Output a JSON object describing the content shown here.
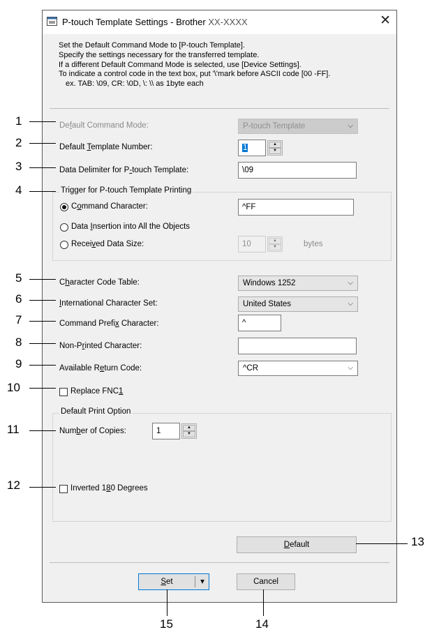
{
  "window": {
    "title": "P-touch Template Settings - Brother",
    "model": "XX-XXXX",
    "close_glyph": "✕"
  },
  "description": {
    "line1": "Set the Default Command Mode to [P-touch Template].",
    "line2": "Specify the settings necessary for the transferred template.",
    "line3": "If a different Default Command Mode is selected, use [Device Settings].",
    "line4": "To indicate a control code in the text box, put '\\'mark before ASCII code [00 -FF].",
    "line5": "ex. TAB: \\09,  CR: \\0D,  \\: \\\\  as 1byte each"
  },
  "fields": {
    "default_command_mode": {
      "label_pre": "De",
      "label_u": "f",
      "label_post": "ault Command Mode:",
      "value": "P-touch Template",
      "enabled": false
    },
    "default_template_number": {
      "label_pre": "Default ",
      "label_u": "T",
      "label_post": "emplate Number:",
      "value": "1"
    },
    "data_delimiter": {
      "label_pre": "Data Delimiter for P",
      "label_u": "-",
      "label_post": "touch Template:",
      "value": "\\09"
    },
    "trigger_group": {
      "label": "Trigger for P-touch Template Printing"
    },
    "command_character": {
      "label_pre": "C",
      "label_u": "o",
      "label_post": "mmand Character:",
      "value": "^FF",
      "selected": true
    },
    "data_insertion": {
      "label_pre": "Data ",
      "label_u": "I",
      "label_post": "nsertion into All the Objects",
      "selected": false
    },
    "received_data_size": {
      "label_pre": "Recei",
      "label_u": "v",
      "label_post": "ed Data Size:",
      "value": "10",
      "unit": "bytes",
      "selected": false
    },
    "character_code_table": {
      "label_pre": "C",
      "label_u": "h",
      "label_post": "aracter Code Table:",
      "value": "Windows 1252"
    },
    "international_character_set": {
      "label_pre": "",
      "label_u": "I",
      "label_post": "nternational Character Set:",
      "value": "United States"
    },
    "command_prefix_character": {
      "label_pre": "Command Prefi",
      "label_u": "x",
      "label_post": " Character:",
      "value": "^"
    },
    "non_printed_character": {
      "label_pre": "Non-P",
      "label_u": "r",
      "label_post": "inted Character:",
      "value": ""
    },
    "available_return_code": {
      "label_pre": "Available R",
      "label_u": "e",
      "label_post": "turn Code:",
      "value": "^CR"
    },
    "replace_fnc1": {
      "label_pre": "Replace FNC",
      "label_u": "1",
      "label_post": "",
      "checked": false
    },
    "default_print_option": {
      "label": "Default Print Option"
    },
    "number_of_copies": {
      "label_pre": "Num",
      "label_u": "b",
      "label_post": "er of Copies:",
      "value": "1"
    },
    "inverted_180": {
      "label_pre": "Inverted 1",
      "label_u": "8",
      "label_post": "0 Degrees",
      "checked": false
    }
  },
  "buttons": {
    "default": {
      "label_pre": "",
      "label_u": "D",
      "label_post": "efault"
    },
    "set": {
      "label_pre": "",
      "label_u": "S",
      "label_post": "et",
      "arrow": "▾"
    },
    "cancel": {
      "label": "Cancel"
    }
  },
  "spinner": {
    "up": "▲",
    "down": "▼"
  },
  "combo_arrow": "⌵",
  "callouts": [
    "1",
    "2",
    "3",
    "4",
    "5",
    "6",
    "7",
    "8",
    "9",
    "10",
    "11",
    "12",
    "13",
    "14",
    "15"
  ]
}
